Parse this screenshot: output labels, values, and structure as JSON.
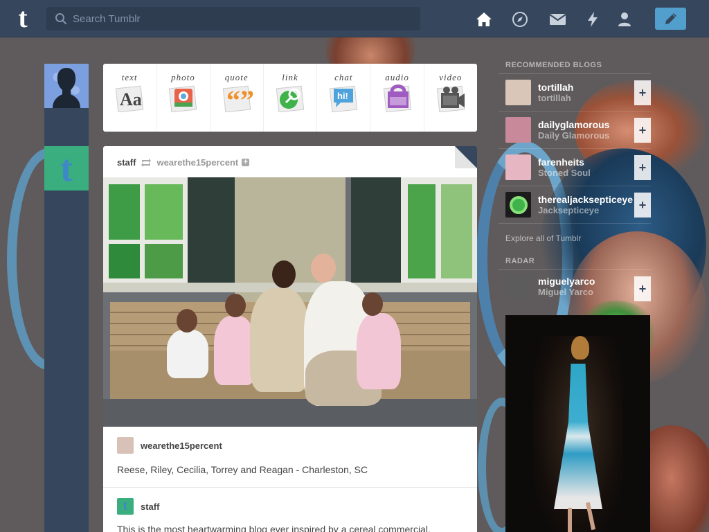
{
  "header": {
    "logo": "t",
    "search_placeholder": "Search Tumblr",
    "nav": [
      {
        "icon": "home-icon"
      },
      {
        "icon": "compass-icon"
      },
      {
        "icon": "mail-icon"
      },
      {
        "icon": "lightning-icon"
      },
      {
        "icon": "account-icon"
      }
    ],
    "compose_icon": "pencil-icon",
    "accent": "#529ecc",
    "bar_color": "#36465d"
  },
  "post_types": [
    {
      "label": "text",
      "icon": "text-icon",
      "glyph": "Aa"
    },
    {
      "label": "photo",
      "icon": "photo-icon"
    },
    {
      "label": "quote",
      "icon": "quote-icon",
      "glyph": "“”"
    },
    {
      "label": "link",
      "icon": "link-icon"
    },
    {
      "label": "chat",
      "icon": "chat-icon",
      "glyph": "hi!"
    },
    {
      "label": "audio",
      "icon": "audio-icon"
    },
    {
      "label": "video",
      "icon": "video-icon"
    }
  ],
  "post": {
    "author": "staff",
    "reblogged_from": "wearethe15percent",
    "source_name": "wearethe15percent",
    "caption": "Reese, Riley, Cecilia, Torrey and Reagan - Charleston, SC",
    "staff_name": "staff",
    "body": "This is the most heartwarming blog ever inspired by a cereal commercial."
  },
  "sidebar": {
    "recommended_heading": "RECOMMENDED BLOGS",
    "recommended": [
      {
        "name": "tortillah",
        "title": "tortillah",
        "color": "#d9c6b8"
      },
      {
        "name": "dailyglamorous",
        "title": "Daily Glamorous",
        "color": "#c88a9a"
      },
      {
        "name": "farenheits",
        "title": "Stoned Soul",
        "color": "#e6b7c2"
      },
      {
        "name": "therealjacksepticeye",
        "title": "Jacksepticeye",
        "color": "#3fb24a"
      }
    ],
    "follow_label": "+",
    "explore": "Explore all of Tumblr",
    "radar_heading": "RADAR",
    "radar": {
      "name": "miguelyarco",
      "title": "Miguel Yarco",
      "color": "#777"
    }
  }
}
